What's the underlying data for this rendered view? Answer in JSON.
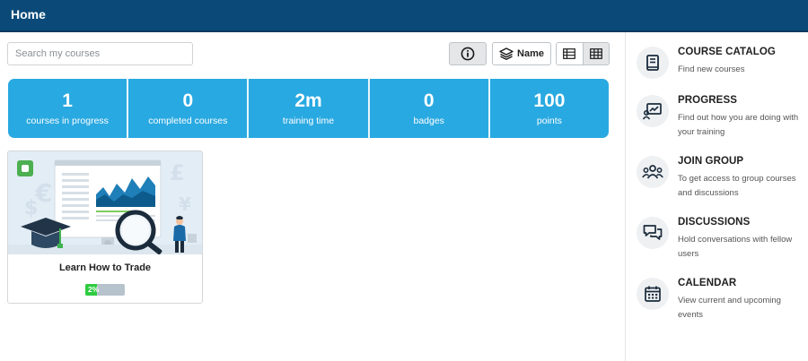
{
  "header": {
    "title": "Home"
  },
  "search": {
    "placeholder": "Search my courses"
  },
  "toolbar": {
    "sort_label": "Name"
  },
  "stats": [
    {
      "value": "1",
      "label": "courses in progress"
    },
    {
      "value": "0",
      "label": "completed courses"
    },
    {
      "value": "2m",
      "label": "training time"
    },
    {
      "value": "0",
      "label": "badges"
    },
    {
      "value": "100",
      "label": "points"
    }
  ],
  "courses": [
    {
      "title": "Learn How to Trade",
      "progress_text": "2%",
      "progress": 0.02
    }
  ],
  "sidebar": {
    "items": [
      {
        "title": "COURSE CATALOG",
        "desc": "Find new courses",
        "icon": "book-icon"
      },
      {
        "title": "PROGRESS",
        "desc": "Find out how you are doing with your training",
        "icon": "progress-chart-icon"
      },
      {
        "title": "JOIN GROUP",
        "desc": "To get access to group courses and discussions",
        "icon": "group-icon"
      },
      {
        "title": "DISCUSSIONS",
        "desc": "Hold conversations with fellow users",
        "icon": "chat-bubbles-icon"
      },
      {
        "title": "CALENDAR",
        "desc": "View current and upcoming events",
        "icon": "calendar-icon"
      }
    ]
  },
  "colors": {
    "header": "#0b4a78",
    "stats_bg": "#29a9e1",
    "progress_fill": "#2ecc40",
    "sidebar_icon": "#1a2b3c"
  }
}
